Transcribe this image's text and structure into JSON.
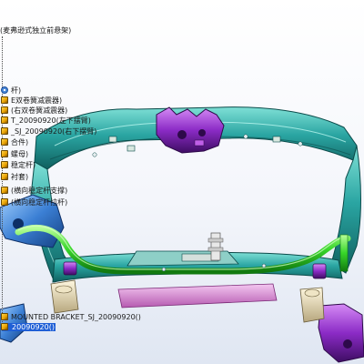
{
  "colors": {
    "frame": "#2aa5a2",
    "frame_dark": "#16706e",
    "stabilizer_bar": "#38d62a",
    "bracket": "#8b2bc6",
    "steering_rack": "#d98ad6",
    "control_arm": "#3b7fd4",
    "selection": "#1f5fd6"
  },
  "tree": {
    "root_label": "(麦弗逊式独立前悬架)",
    "items": [
      {
        "label": "杆)",
        "icon": "gear-icon"
      },
      {
        "label": "E双卷簧减震器)",
        "icon": "part-icon"
      },
      {
        "label": "(右双卷簧减震器)",
        "icon": "part-icon"
      },
      {
        "label": "T_20090920(左下摆臂)",
        "icon": "part-icon"
      },
      {
        "label": "_SJ_20090920(右下摆臂)",
        "icon": "part-icon"
      },
      {
        "label": "合件)",
        "icon": "part-icon"
      },
      {
        "label": "螺母)",
        "icon": "part-icon"
      },
      {
        "label": "稳定杆)",
        "icon": "part-icon"
      },
      {
        "label": "衬套)",
        "icon": "part-icon"
      },
      {
        "label": "(横向稳定杆支撑)",
        "icon": "part-icon"
      },
      {
        "label": "(横向稳定杆拉杆)",
        "icon": "part-icon"
      },
      {
        "label": "MOUNTED BRACKET_SJ_20090920()",
        "icon": "part-icon"
      },
      {
        "label": "20090920()",
        "icon": "part-icon",
        "selected": true
      }
    ]
  }
}
